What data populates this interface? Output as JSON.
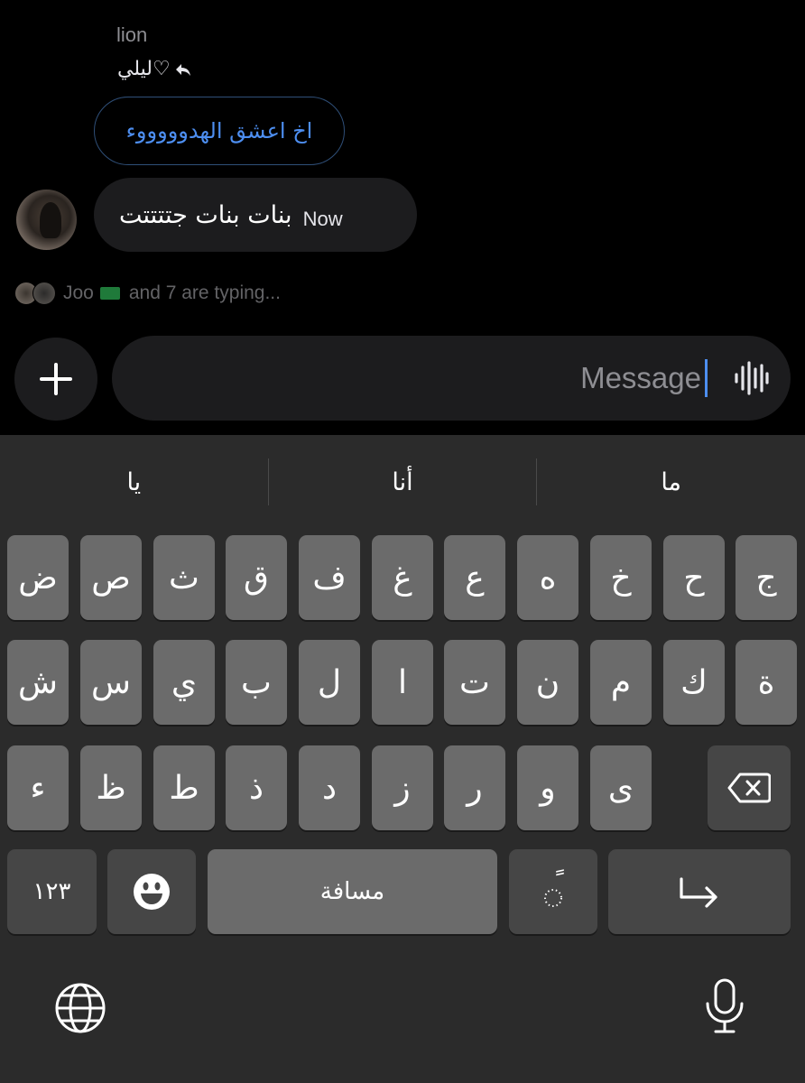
{
  "chat": {
    "sender_name": "lion",
    "reply_to": "ليلي♡",
    "quoted_message": "اخ اعشق الهدوووووء",
    "message": {
      "text": "بنات بنات جتتتتت",
      "time": "Now"
    },
    "typing": {
      "name": "Joo",
      "suffix": "and 7 are typing..."
    }
  },
  "composer": {
    "placeholder": "Message"
  },
  "keyboard": {
    "suggestions": [
      "يا",
      "أنا",
      "ما"
    ],
    "row1": [
      "ض",
      "ص",
      "ث",
      "ق",
      "ف",
      "غ",
      "ع",
      "ه",
      "خ",
      "ح",
      "ج"
    ],
    "row2": [
      "ش",
      "س",
      "ي",
      "ب",
      "ل",
      "ا",
      "ت",
      "ن",
      "م",
      "ك",
      "ة"
    ],
    "row3": [
      "ء",
      "ظ",
      "ط",
      "ذ",
      "د",
      "ز",
      "ر",
      "و",
      "ى"
    ],
    "numbers_label": "١٢٣",
    "space_label": "مسافة",
    "diacritic_label": "ً"
  },
  "colors": {
    "accent": "#4d8ef0",
    "bubble": "#1c1c1e",
    "key": "#6b6b6b",
    "key_dark": "#464646",
    "keyboard_bg": "#2b2b2b"
  }
}
